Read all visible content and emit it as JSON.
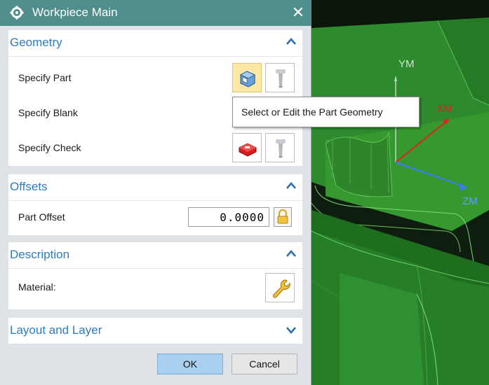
{
  "window": {
    "title": "Workpiece Main",
    "close_symbol": "✕"
  },
  "sections": {
    "geometry": {
      "title": "Geometry",
      "rows": {
        "part": "Specify Part",
        "blank": "Specify Blank",
        "check": "Specify Check"
      },
      "expanded": true
    },
    "offsets": {
      "title": "Offsets",
      "part_offset_label": "Part Offset",
      "part_offset_value": "0.0000",
      "expanded": true
    },
    "description": {
      "title": "Description",
      "material_label": "Material:",
      "expanded": true
    },
    "layout": {
      "title": "Layout and Layer",
      "expanded": false
    }
  },
  "tooltip": "Select or Edit the Part Geometry",
  "buttons": {
    "ok": "OK",
    "cancel": "Cancel"
  },
  "viewport": {
    "axes": {
      "y": "YM",
      "x": "XM",
      "z": "ZM"
    }
  },
  "colors": {
    "titlebar": "#4f8e8c",
    "section_title": "#2f7bbf",
    "model_green": "#2a8a2a",
    "axis_x": "#e02020",
    "axis_z": "#3a7cff",
    "ok_button": "#a9d0ee"
  },
  "icons": [
    "gear-icon",
    "close-icon",
    "part-geometry-icon",
    "part-display-icon",
    "blank-display-icon",
    "check-geometry-icon",
    "check-display-icon",
    "lock-icon",
    "wrench-icon",
    "chevron-up-icon",
    "chevron-down-icon"
  ]
}
